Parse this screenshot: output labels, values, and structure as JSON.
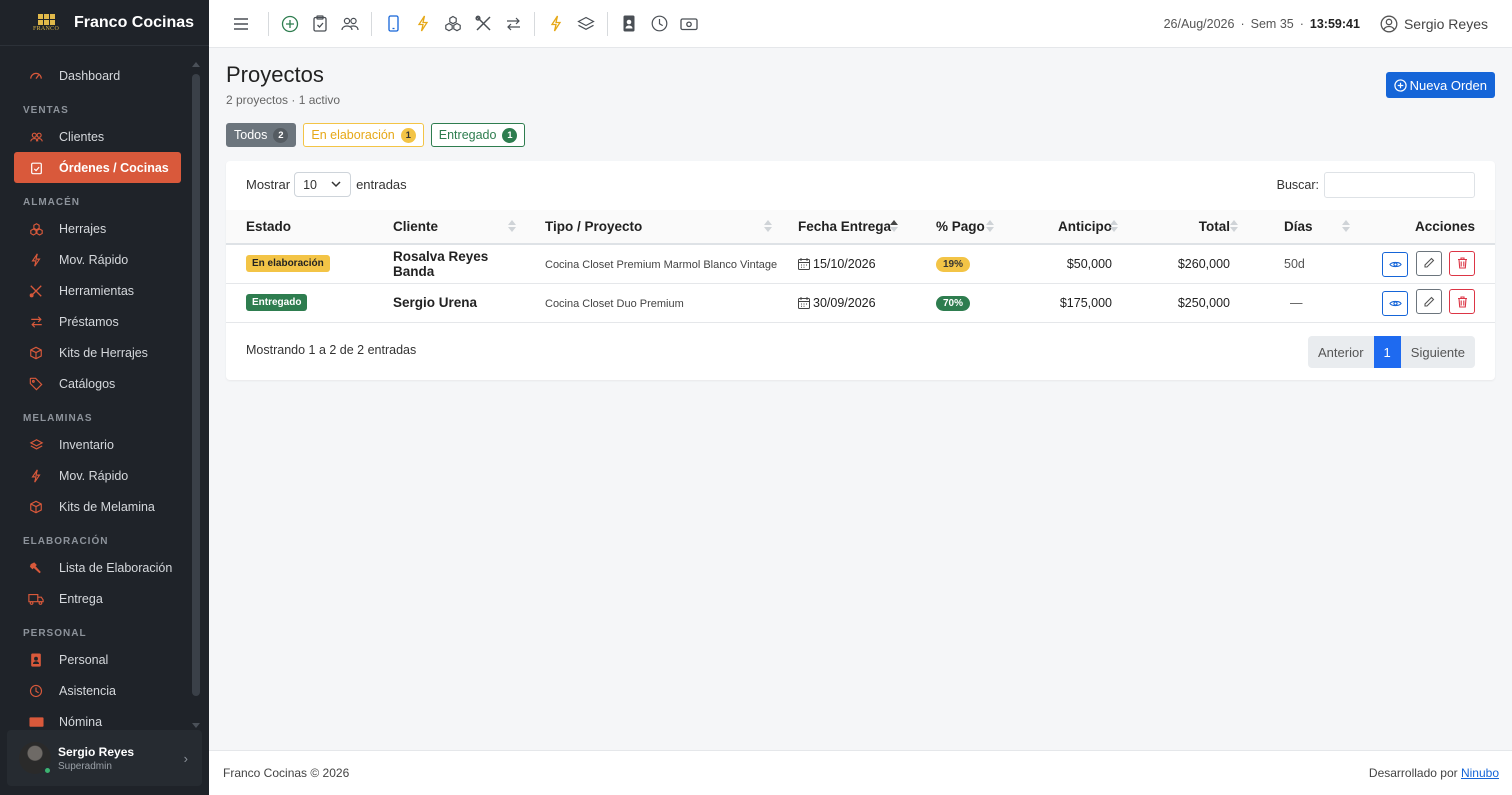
{
  "brand": {
    "name": "Franco Cocinas",
    "logo_text": "FRANCO"
  },
  "sidebar": {
    "top": [
      {
        "label": "Dashboard",
        "icon": "dashboard-icon"
      }
    ],
    "sections": [
      {
        "title": "VENTAS",
        "items": [
          {
            "label": "Clientes",
            "icon": "users-icon"
          },
          {
            "label": "Órdenes / Cocinas",
            "icon": "clipboard-icon",
            "active": true
          }
        ]
      },
      {
        "title": "ALMACÉN",
        "items": [
          {
            "label": "Herrajes",
            "icon": "boxes-icon"
          },
          {
            "label": "Mov. Rápido",
            "icon": "lightning-icon"
          },
          {
            "label": "Herramientas",
            "icon": "tools-icon"
          },
          {
            "label": "Préstamos",
            "icon": "arrows-icon"
          },
          {
            "label": "Kits de Herrajes",
            "icon": "box-icon"
          },
          {
            "label": "Catálogos",
            "icon": "tag-icon"
          }
        ]
      },
      {
        "title": "MELAMINAS",
        "items": [
          {
            "label": "Inventario",
            "icon": "layers-icon"
          },
          {
            "label": "Mov. Rápido",
            "icon": "lightning-icon"
          },
          {
            "label": "Kits de Melamina",
            "icon": "box-icon"
          }
        ]
      },
      {
        "title": "ELABORACIÓN",
        "items": [
          {
            "label": "Lista de Elaboración",
            "icon": "hammer-icon"
          },
          {
            "label": "Entrega",
            "icon": "truck-icon"
          }
        ]
      },
      {
        "title": "PERSONAL",
        "items": [
          {
            "label": "Personal",
            "icon": "badge-icon"
          },
          {
            "label": "Asistencia",
            "icon": "clock-icon"
          },
          {
            "label": "Nómina",
            "icon": "cash-icon"
          }
        ]
      }
    ],
    "user": {
      "name": "Sergio Reyes",
      "role": "Superadmin"
    }
  },
  "topbar": {
    "date": "26/Aug/2026",
    "week": "Sem 35",
    "time": "13:59:41",
    "user": "Sergio Reyes"
  },
  "page": {
    "title": "Proyectos",
    "subtitle": "2 proyectos · 1 activo",
    "new_button": "Nueva Orden"
  },
  "filters": [
    {
      "label": "Todos",
      "count": "2"
    },
    {
      "label": "En elaboración",
      "count": "1"
    },
    {
      "label": "Entregado",
      "count": "1"
    }
  ],
  "table": {
    "show_label": "Mostrar",
    "show_value": "10",
    "entries_label": "entradas",
    "search_label": "Buscar:",
    "search_value": "",
    "headers": [
      "Estado",
      "Cliente",
      "Tipo / Proyecto",
      "Fecha Entrega",
      "% Pago",
      "Anticipo",
      "Total",
      "Días",
      "Acciones"
    ],
    "rows": [
      {
        "estado": "En elaboración",
        "cliente": "Rosalva Reyes Banda",
        "tipo": "Cocina Closet Premium Marmol Blanco Vintage",
        "fecha": "15/10/2026",
        "pago": "19%",
        "anticipo": "$50,000",
        "total": "$260,000",
        "dias": "50d"
      },
      {
        "estado": "Entregado",
        "cliente": "Sergio Urena",
        "tipo": "Cocina Closet Duo Premium",
        "fecha": "30/09/2026",
        "pago": "70%",
        "anticipo": "$175,000",
        "total": "$250,000",
        "dias": "—"
      }
    ],
    "info": "Mostrando 1 a 2 de 2 entradas",
    "pager": {
      "prev": "Anterior",
      "current": "1",
      "next": "Siguiente"
    }
  },
  "footer": {
    "copyright": "Franco Cocinas © 2026",
    "dev_label": "Desarrollado por",
    "dev_link": "Ninubo"
  },
  "colors": {
    "accent": "#d9593b",
    "primary": "#1565d8",
    "warning": "#f3c446",
    "success": "#2e7d4f",
    "sidebar": "#1f2329"
  }
}
